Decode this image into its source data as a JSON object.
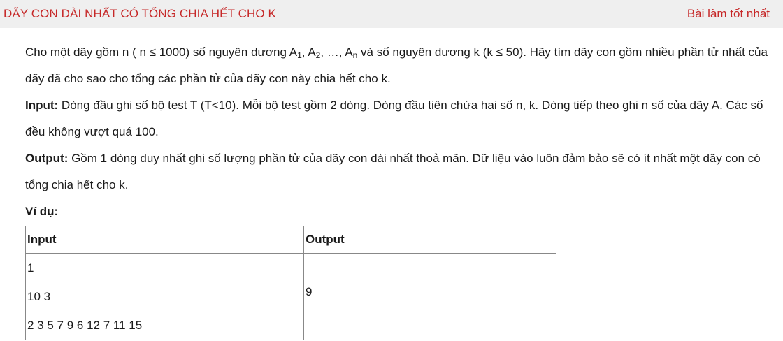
{
  "header": {
    "title": "DÃY CON DÀI NHẤT CÓ TỔNG CHIA HẾT CHO K",
    "best_link": "Bài làm tốt nhất"
  },
  "statement": {
    "p1_a": "Cho một dãy gồm n ( n ≤ 1000) số nguyên dương A",
    "sub1": "1",
    "sep1": ", A",
    "sub2": "2",
    "sep2": ", …, A",
    "subn": "n",
    "p1_b": " và số nguyên dương k (k ≤ 50). Hãy tìm dãy con gồm nhiều phần tử nhất của dãy đã cho sao cho tổng các phần tử của dãy con này chia hết cho k.",
    "input_label": "Input:",
    "input_text": " Dòng đầu ghi số bộ test T (T<10). Mỗi bộ test gồm 2 dòng. Dòng đầu tiên chứa hai số n, k.  Dòng tiếp theo ghi n số của dãy A. Các số đều không vượt quá 100.",
    "output_label": "Output:",
    "output_text": " Gồm 1 dòng duy nhất ghi số lượng phần tử của dãy con dài nhất thoả mãn. Dữ liệu vào luôn đảm bảo sẽ có ít nhất một dãy con có tổng chia hết cho k.",
    "example_label": "Ví dụ:"
  },
  "example": {
    "headers": [
      "Input",
      "Output"
    ],
    "input_lines": [
      "1",
      "10 3",
      "2 3 5 7 9 6 12 7 11 15"
    ],
    "output": "9"
  }
}
